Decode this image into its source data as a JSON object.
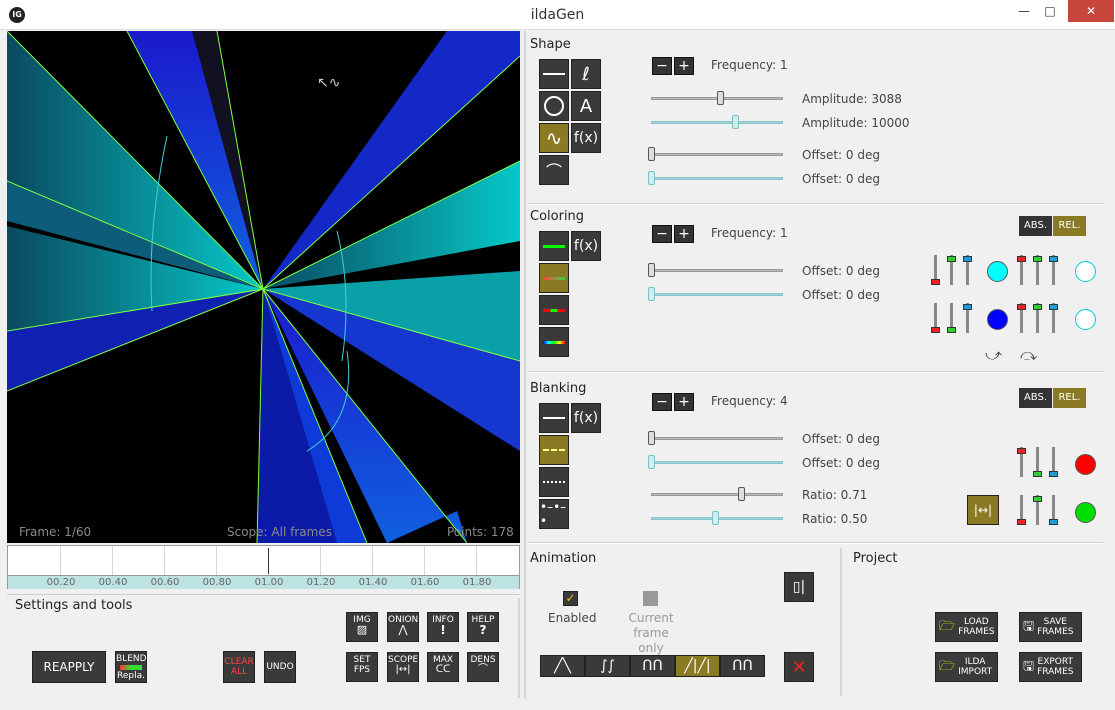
{
  "window": {
    "title": "ildaGen",
    "logo": "IG",
    "min": "—",
    "max": "□",
    "close": "✕"
  },
  "canvas": {
    "frame": "Frame: 1/60",
    "scope": "Scope: All frames",
    "points": "Points: 178"
  },
  "timeline": {
    "labels": [
      "00.20",
      "00.40",
      "00.60",
      "00.80",
      "01.00",
      "01.20",
      "01.40",
      "01.60",
      "01.80"
    ]
  },
  "settings": {
    "title": "Settings and tools",
    "reapply": "REAPPLY",
    "blend": [
      "BLEND",
      "Repla."
    ],
    "clear": [
      "CLEAR",
      "ALL"
    ],
    "undo": "UNDO",
    "tools": [
      [
        "IMG",
        ""
      ],
      [
        "ONION",
        ""
      ],
      [
        "INFO",
        "!"
      ],
      [
        "HELP",
        "?"
      ],
      [
        "SET",
        "FPS"
      ],
      [
        "SCOPE",
        ""
      ],
      [
        "MAX",
        ""
      ],
      [
        "DENS",
        ""
      ]
    ]
  },
  "shape": {
    "title": "Shape",
    "minus": "−",
    "plus": "+",
    "frequency": "Frequency: 1",
    "amp1": "Amplitude: 3088",
    "amp2": "Amplitude: 10000",
    "off1": "Offset: 0 deg",
    "off2": "Offset: 0 deg"
  },
  "coloring": {
    "title": "Coloring",
    "minus": "−",
    "plus": "+",
    "frequency": "Frequency: 1",
    "off1": "Offset: 0 deg",
    "off2": "Offset: 0 deg",
    "abs": "ABS.",
    "rel": "REL."
  },
  "blanking": {
    "title": "Blanking",
    "minus": "−",
    "plus": "+",
    "frequency": "Frequency: 4",
    "off1": "Offset: 0 deg",
    "off2": "Offset: 0 deg",
    "ratio1": "Ratio: 0.71",
    "ratio2": "Ratio: 0.50",
    "abs": "ABS.",
    "rel": "REL."
  },
  "animation": {
    "title": "Animation",
    "enabled": "Enabled",
    "current": [
      "Current",
      "frame only"
    ]
  },
  "project": {
    "title": "Project",
    "load": [
      "LOAD",
      "FRAMES"
    ],
    "save": [
      "SAVE",
      "FRAMES"
    ],
    "ilda": [
      "ILDA",
      "IMPORT"
    ],
    "export": [
      "EXPORT",
      "FRAMES"
    ]
  },
  "colors": {
    "active": "#8b7a24",
    "dark": "#3a3a3a",
    "cyan": "#00ffff",
    "blue": "#0000ff",
    "red": "#ff0000",
    "green": "#00dd00"
  }
}
